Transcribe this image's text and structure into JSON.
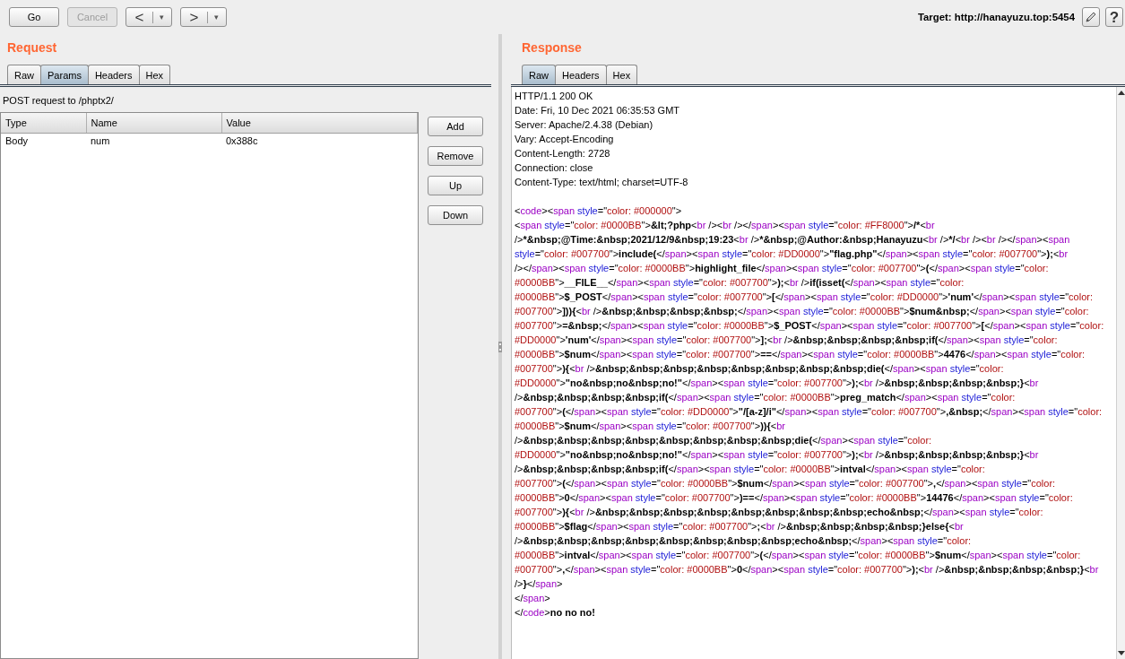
{
  "toolbar": {
    "buttons": [
      {
        "kind": "text",
        "label": "Go",
        "disabled": false
      },
      {
        "kind": "text",
        "label": "Cancel",
        "disabled": true
      },
      {
        "kind": "split",
        "label": "<",
        "menu": "▾",
        "disabled": false
      },
      {
        "kind": "split",
        "label": ">",
        "menu": "▾",
        "disabled": false
      }
    ],
    "target": "Target: http://hanayuzu.top:5454",
    "help": "?"
  },
  "request": {
    "title": "Request",
    "tabs": [
      {
        "label": "Raw",
        "selected": false
      },
      {
        "label": "Params",
        "selected": true
      },
      {
        "label": "Headers",
        "selected": false
      },
      {
        "label": "Hex",
        "selected": false
      }
    ],
    "summary": "POST request to /phptx2/",
    "table": {
      "columns": [
        "Type",
        "Name",
        "Value"
      ],
      "rows": [
        [
          "Body",
          "num",
          "0x388c"
        ]
      ]
    },
    "buttons": [
      "Add",
      "Remove",
      "Up",
      "Down"
    ]
  },
  "response": {
    "title": "Response",
    "tabs": [
      {
        "label": "Raw",
        "selected": true
      },
      {
        "label": "Headers",
        "selected": false
      },
      {
        "label": "Hex",
        "selected": false
      }
    ],
    "headers": [
      "HTTP/1.1 200 OK",
      "Date: Fri, 10 Dec 2021 06:35:53 GMT",
      "Server: Apache/2.4.38 (Debian)",
      "Vary: Accept-Encoding",
      "Content-Length: 2728",
      "Connection: close",
      "Content-Type: text/html; charset=UTF-8"
    ],
    "body_lines": [
      "<code><span style=\"color: #000000\">",
      "<span style=\"color: #0000BB\">&lt;?php<br /><br /></span><span style=\"color: #FF8000\">/*<br",
      "/>*&nbsp;@Time:&nbsp;2021/12/9&nbsp;19:23<br />*&nbsp;@Author:&nbsp;Hanayuzu<br />*/<br /><br /></span><span",
      "style=\"color: #007700\">include(</span><span style=\"color: #DD0000\">\"flag.php\"</span><span style=\"color: #007700\">);<br",
      "/></span><span style=\"color: #0000BB\">highlight_file</span><span style=\"color: #007700\">(</span><span style=\"color:",
      "#0000BB\">__FILE__</span><span style=\"color: #007700\">);<br />if(isset(</span><span style=\"color:",
      "#0000BB\">$_POST</span><span style=\"color: #007700\">[</span><span style=\"color: #DD0000\">'num'</span><span style=\"color:",
      "#007700\">])){<br />&nbsp;&nbsp;&nbsp;&nbsp;</span><span style=\"color: #0000BB\">$num&nbsp;</span><span style=\"color:",
      "#007700\">=&nbsp;</span><span style=\"color: #0000BB\">$_POST</span><span style=\"color: #007700\">[</span><span style=\"color:",
      "#DD0000\">'num'</span><span style=\"color: #007700\">];<br />&nbsp;&nbsp;&nbsp;&nbsp;if(</span><span style=\"color:",
      "#0000BB\">$num</span><span style=\"color: #007700\">==</span><span style=\"color: #0000BB\">4476</span><span style=\"color:",
      "#007700\">){<br />&nbsp;&nbsp;&nbsp;&nbsp;&nbsp;&nbsp;&nbsp;&nbsp;die(</span><span style=\"color:",
      "#DD0000\">\"no&nbsp;no&nbsp;no!\"</span><span style=\"color: #007700\">);<br />&nbsp;&nbsp;&nbsp;&nbsp;}<br",
      "/>&nbsp;&nbsp;&nbsp;&nbsp;if(</span><span style=\"color: #0000BB\">preg_match</span><span style=\"color:",
      "#007700\">(</span><span style=\"color: #DD0000\">\"/[a-z]/i\"</span><span style=\"color: #007700\">,&nbsp;</span><span style=\"color:",
      "#0000BB\">$num</span><span style=\"color: #007700\">)){<br",
      "/>&nbsp;&nbsp;&nbsp;&nbsp;&nbsp;&nbsp;&nbsp;&nbsp;die(</span><span style=\"color:",
      "#DD0000\">\"no&nbsp;no&nbsp;no!\"</span><span style=\"color: #007700\">);<br />&nbsp;&nbsp;&nbsp;&nbsp;}<br",
      "/>&nbsp;&nbsp;&nbsp;&nbsp;if(</span><span style=\"color: #0000BB\">intval</span><span style=\"color:",
      "#007700\">(</span><span style=\"color: #0000BB\">$num</span><span style=\"color: #007700\">,</span><span style=\"color:",
      "#0000BB\">0</span><span style=\"color: #007700\">)==</span><span style=\"color: #0000BB\">14476</span><span style=\"color:",
      "#007700\">){<br />&nbsp;&nbsp;&nbsp;&nbsp;&nbsp;&nbsp;&nbsp;&nbsp;echo&nbsp;</span><span style=\"color:",
      "#0000BB\">$flag</span><span style=\"color: #007700\">;<br />&nbsp;&nbsp;&nbsp;&nbsp;}else{<br",
      "/>&nbsp;&nbsp;&nbsp;&nbsp;&nbsp;&nbsp;&nbsp;&nbsp;echo&nbsp;</span><span style=\"color:",
      "#0000BB\">intval</span><span style=\"color: #007700\">(</span><span style=\"color: #0000BB\">$num</span><span style=\"color:",
      "#007700\">,</span><span style=\"color: #0000BB\">0</span><span style=\"color: #007700\">);<br />&nbsp;&nbsp;&nbsp;&nbsp;}<br",
      "/>}</span>",
      "</span>",
      "</code>no no no!"
    ]
  }
}
